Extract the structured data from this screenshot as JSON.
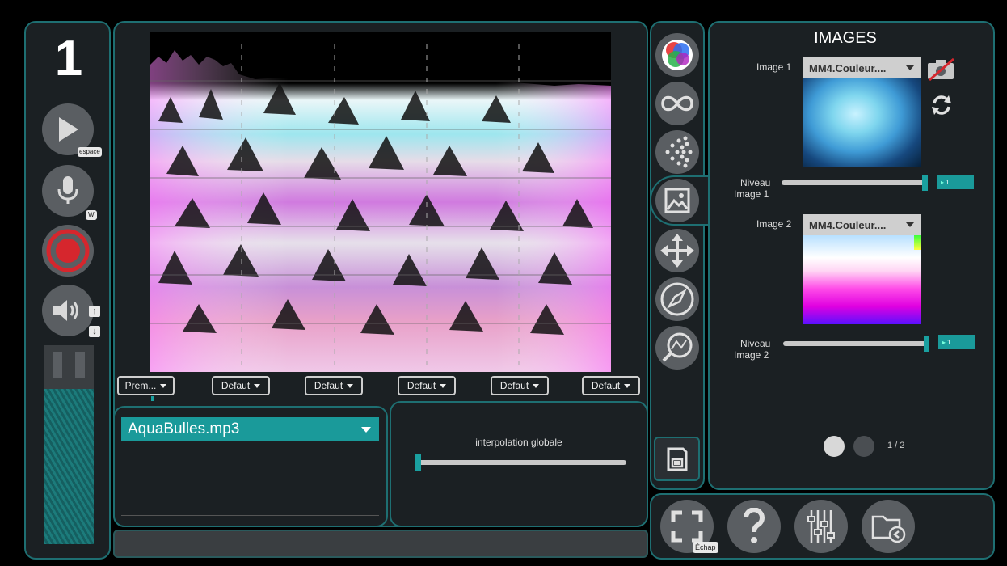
{
  "left": {
    "number": "1",
    "play_hint": "espace",
    "mic_hint": "W",
    "vol_up": "↑",
    "vol_down": "↓",
    "level_fraction": 0.78
  },
  "main": {
    "dropdowns": [
      "Prem...",
      "Defaut",
      "Defaut",
      "Defaut",
      "Defaut",
      "Defaut"
    ],
    "track": "AquaBulles.mp3",
    "interpolation_label": "interpolation globale",
    "interpolation_value": 0.0
  },
  "images_panel": {
    "title": "IMAGES",
    "image1_label": "Image 1",
    "image1_select": "MM4.Couleur....",
    "niveau1_line1": "Niveau",
    "niveau1_line2": "Image 1",
    "niveau1_value": "1.",
    "niveau1_fraction": 1.0,
    "image2_label": "Image 2",
    "image2_select": "MM4.Couleur....",
    "niveau2_line1": "Niveau",
    "niveau2_line2": "Image 2",
    "niveau2_value": "1.",
    "niveau2_fraction": 1.0,
    "page": "1 / 2"
  },
  "bottom": {
    "fullscreen_hint": "Échap"
  },
  "colors": {
    "accent": "#1aa0a0",
    "border": "#1e6f72",
    "panel": "#1b2023",
    "icon_bg": "#5a5e62"
  }
}
